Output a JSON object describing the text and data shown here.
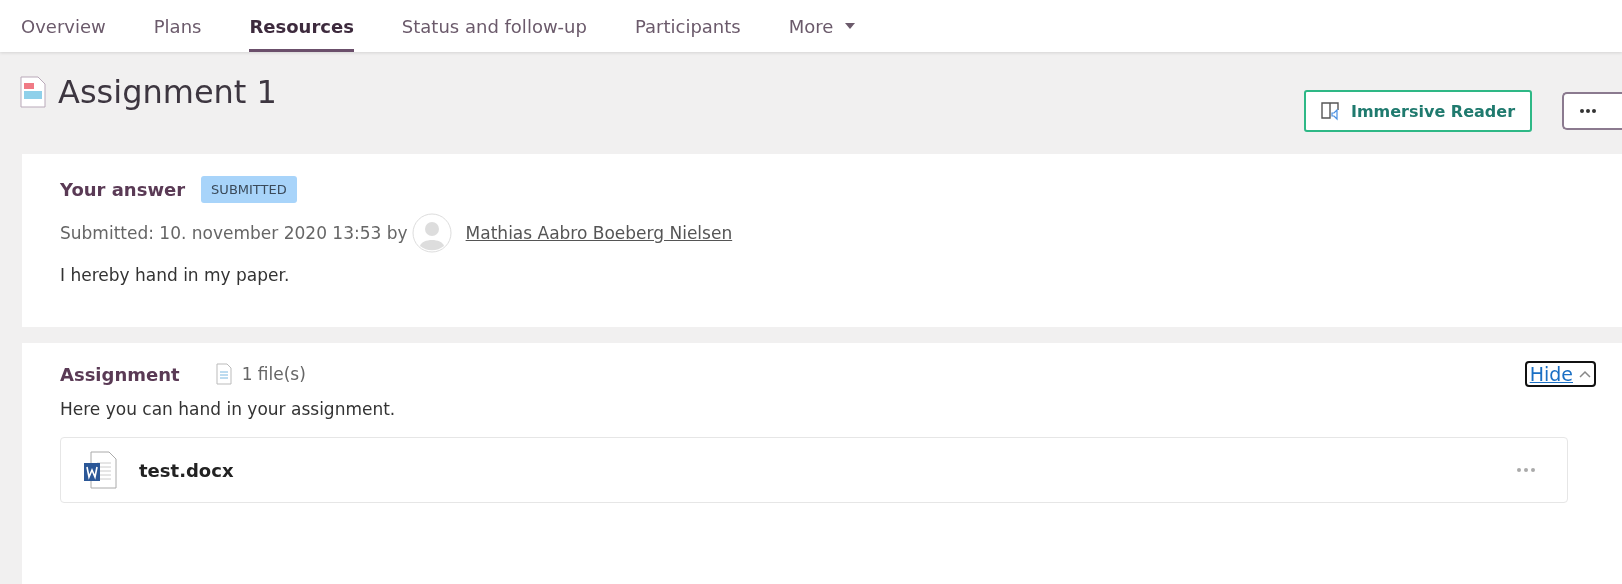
{
  "tabs": [
    {
      "label": "Overview",
      "selected": false
    },
    {
      "label": "Plans",
      "selected": false
    },
    {
      "label": "Resources",
      "selected": true
    },
    {
      "label": "Status and follow-up",
      "selected": false
    },
    {
      "label": "Participants",
      "selected": false
    },
    {
      "label": "More",
      "selected": false,
      "kind": "dropdown"
    }
  ],
  "title": "Assignment 1",
  "immersive_reader": "Immersive Reader",
  "answer": {
    "heading": "Your answer",
    "status": "SUBMITTED",
    "submitted": "Submitted: 10. november 2020 13:53 by",
    "author": "Mathias Aabro Boeberg Nielsen",
    "text": "I hereby hand in my paper."
  },
  "assignment": {
    "heading": "Assignment",
    "file_count": "1 file(s)",
    "hide": "Hide",
    "expanded": true,
    "text": "Here you can hand in your assignment.",
    "files": [
      {
        "name": "test.docx"
      }
    ]
  }
}
